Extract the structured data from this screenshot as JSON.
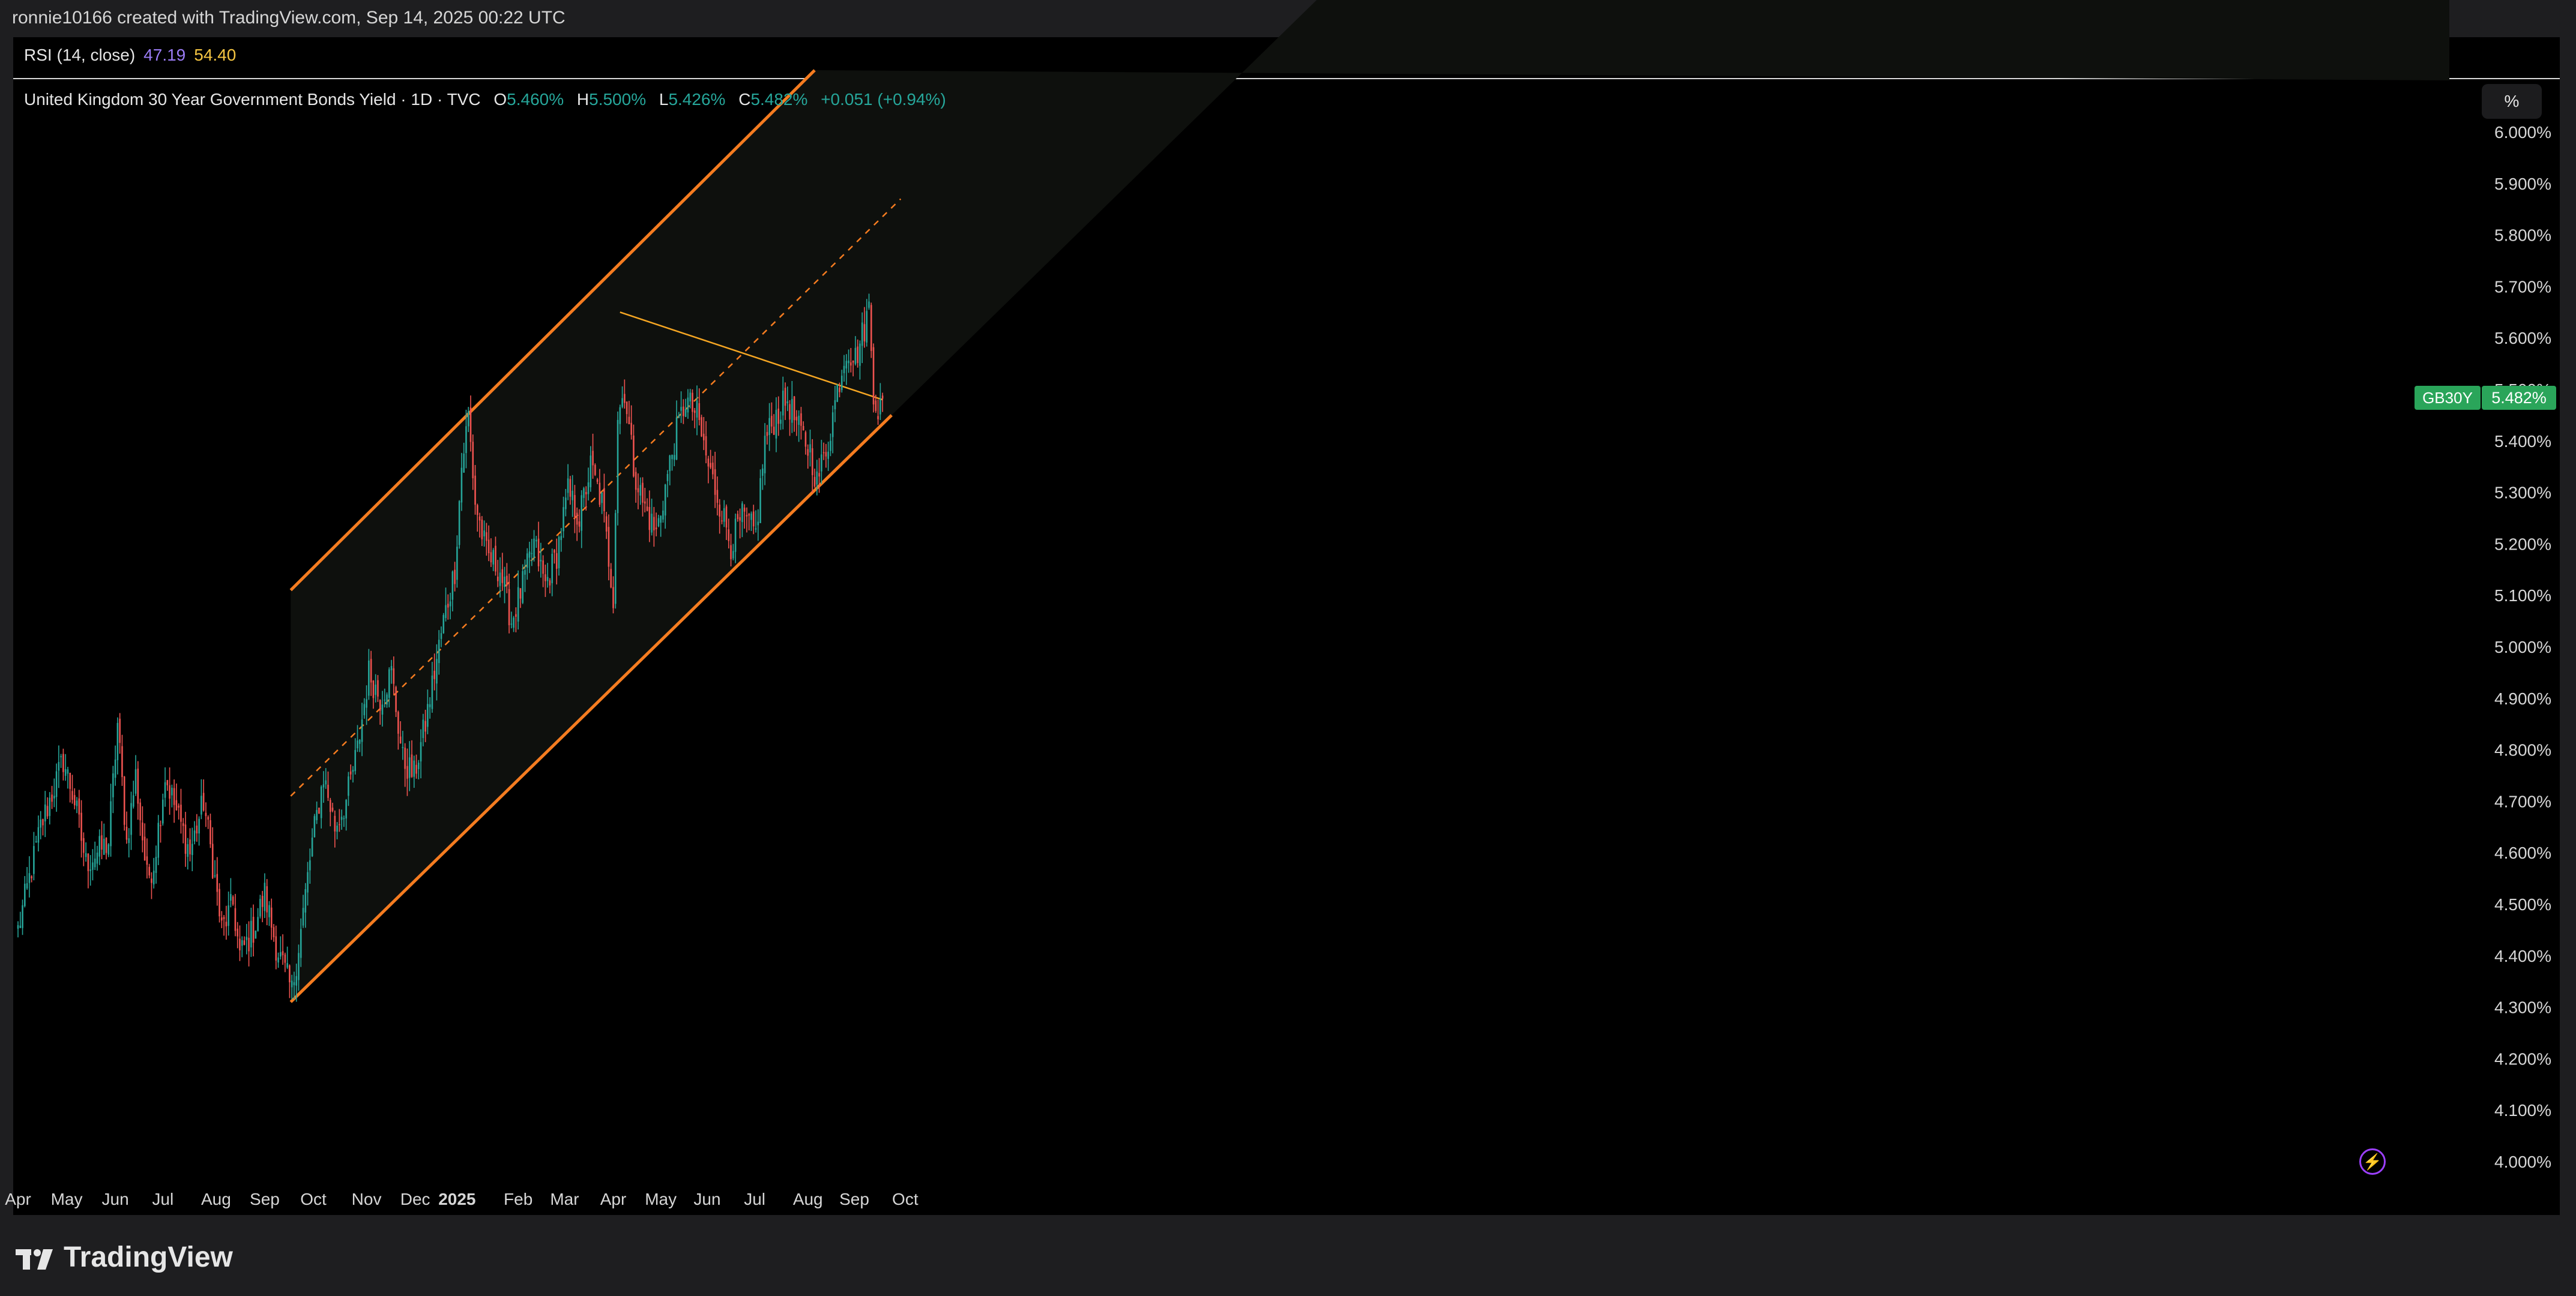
{
  "header": {
    "attribution": "ronnie10166 created with TradingView.com, Sep 14, 2025 00:22 UTC"
  },
  "rsi": {
    "label": "RSI (14, close)",
    "value1": "47.19",
    "value2": "54.40"
  },
  "legend": {
    "title": "United Kingdom 30 Year Government Bonds Yield · 1D · TVC",
    "open_label": "O",
    "open": "5.460%",
    "high_label": "H",
    "high": "5.500%",
    "low_label": "L",
    "low": "5.426%",
    "close_label": "C",
    "close": "5.482%",
    "change": "+0.051 (+0.94%)"
  },
  "axis_unit_button": "%",
  "symbol_tag": "GB30Y",
  "last_price_tag": "5.482%",
  "branding": "TradingView",
  "colors": {
    "up": "#26a69a",
    "down": "#ef5350",
    "channel": "#f57c20",
    "trendline": "#f5a623",
    "background": "#000000"
  },
  "chart_data": {
    "type": "candlestick",
    "title": "United Kingdom 30 Year Government Bonds Yield · 1D · TVC",
    "ylabel": "%",
    "ylim": [
      3.96,
      6.06
    ],
    "y_ticks": [
      "6.000%",
      "5.900%",
      "5.800%",
      "5.700%",
      "5.600%",
      "5.500%",
      "5.400%",
      "5.300%",
      "5.200%",
      "5.100%",
      "5.000%",
      "4.900%",
      "4.800%",
      "4.700%",
      "4.600%",
      "4.500%",
      "4.400%",
      "4.300%",
      "4.200%",
      "4.100%",
      "4.000%"
    ],
    "x_ticks": [
      "Apr",
      "May",
      "Jun",
      "Jul",
      "Aug",
      "Sep",
      "Oct",
      "Nov",
      "Dec",
      "2025",
      "Feb",
      "Mar",
      "Apr",
      "May",
      "Jun",
      "Jul",
      "Aug",
      "Sep",
      "Oct"
    ],
    "x_tick_index": [
      0,
      21.5,
      43,
      64,
      87.5,
      109,
      130.5,
      154,
      175.5,
      194,
      221,
      241.5,
      263,
      284,
      304.5,
      325.5,
      349,
      369.5,
      392
    ],
    "anchors": [
      [
        0,
        4.45
      ],
      [
        10,
        4.65
      ],
      [
        20,
        4.78
      ],
      [
        25,
        4.7
      ],
      [
        30,
        4.58
      ],
      [
        40,
        4.62
      ],
      [
        44,
        4.85
      ],
      [
        48,
        4.62
      ],
      [
        52,
        4.75
      ],
      [
        57,
        4.55
      ],
      [
        60,
        4.58
      ],
      [
        65,
        4.75
      ],
      [
        70,
        4.68
      ],
      [
        76,
        4.6
      ],
      [
        82,
        4.7
      ],
      [
        86,
        4.58
      ],
      [
        90,
        4.45
      ],
      [
        95,
        4.5
      ],
      [
        98,
        4.4
      ],
      [
        104,
        4.45
      ],
      [
        109,
        4.52
      ],
      [
        114,
        4.42
      ],
      [
        121,
        4.33
      ],
      [
        125,
        4.45
      ],
      [
        130,
        4.62
      ],
      [
        135,
        4.75
      ],
      [
        140,
        4.65
      ],
      [
        145,
        4.7
      ],
      [
        150,
        4.8
      ],
      [
        155,
        4.95
      ],
      [
        160,
        4.9
      ],
      [
        165,
        4.95
      ],
      [
        170,
        4.78
      ],
      [
        175,
        4.75
      ],
      [
        180,
        4.85
      ],
      [
        188,
        5.05
      ],
      [
        193,
        5.15
      ],
      [
        196,
        5.35
      ],
      [
        199,
        5.45
      ],
      [
        202,
        5.28
      ],
      [
        207,
        5.18
      ],
      [
        213,
        5.15
      ],
      [
        218,
        5.05
      ],
      [
        223,
        5.12
      ],
      [
        228,
        5.2
      ],
      [
        233,
        5.12
      ],
      [
        238,
        5.18
      ],
      [
        243,
        5.3
      ],
      [
        248,
        5.25
      ],
      [
        253,
        5.35
      ],
      [
        258,
        5.28
      ],
      [
        263,
        5.1
      ],
      [
        265,
        5.45
      ],
      [
        268,
        5.5
      ],
      [
        272,
        5.35
      ],
      [
        276,
        5.28
      ],
      [
        282,
        5.22
      ],
      [
        290,
        5.4
      ],
      [
        295,
        5.48
      ],
      [
        300,
        5.45
      ],
      [
        305,
        5.35
      ],
      [
        310,
        5.28
      ],
      [
        315,
        5.2
      ],
      [
        320,
        5.25
      ],
      [
        326,
        5.22
      ],
      [
        330,
        5.4
      ],
      [
        335,
        5.45
      ],
      [
        340,
        5.48
      ],
      [
        345,
        5.42
      ],
      [
        350,
        5.38
      ],
      [
        353,
        5.32
      ],
      [
        358,
        5.4
      ],
      [
        362,
        5.5
      ],
      [
        366,
        5.58
      ],
      [
        370,
        5.56
      ],
      [
        374,
        5.62
      ],
      [
        376,
        5.66
      ],
      [
        378,
        5.5
      ],
      [
        380,
        5.46
      ],
      [
        382,
        5.48
      ]
    ],
    "last_close": 5.482,
    "overlays": {
      "channel_upper": [
        [
          120.5,
          5.11
        ],
        [
          352,
          6.12
        ]
      ],
      "channel_lower": [
        [
          120.5,
          4.31
        ],
        [
          386,
          5.45
        ]
      ],
      "channel_mid": [
        [
          120.5,
          4.71
        ],
        [
          390,
          5.87
        ]
      ],
      "descending_trendline": [
        [
          266,
          5.65
        ],
        [
          382,
          5.48
        ]
      ]
    }
  }
}
